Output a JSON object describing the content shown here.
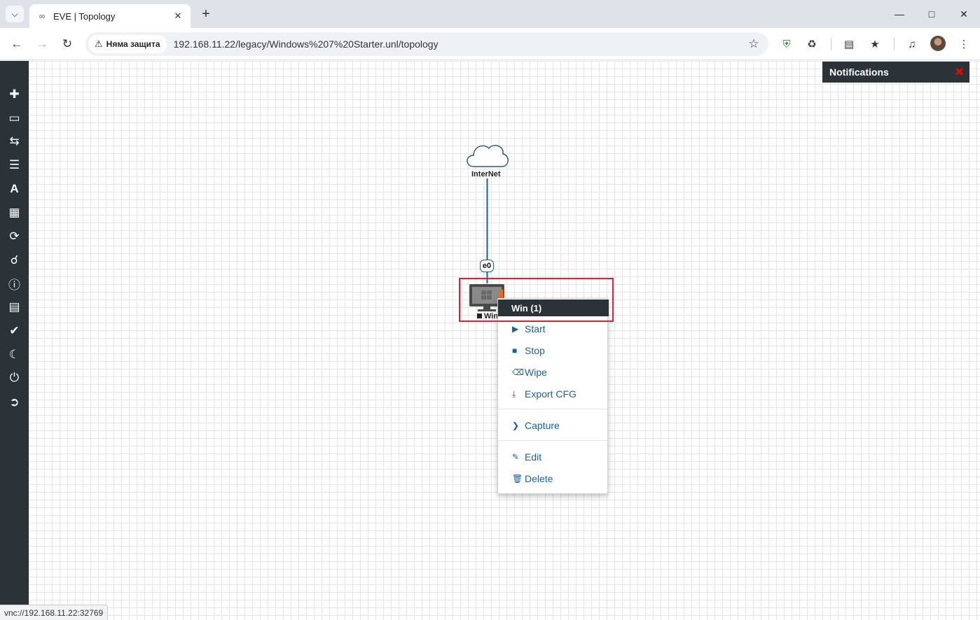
{
  "browser": {
    "tab_title": "EVE | Topology",
    "security_label": "Няма защита",
    "url": "192.168.11.22/legacy/Windows%207%20Starter.unl/topology",
    "status_url": "vnc://192.168.11.22:32769"
  },
  "notifications": {
    "title": "Notifications"
  },
  "sidebar": {
    "items": [
      {
        "icon": "plus-icon"
      },
      {
        "icon": "drive-icon"
      },
      {
        "icon": "transfer-icon"
      },
      {
        "icon": "align-left-icon"
      },
      {
        "icon": "font-icon"
      },
      {
        "icon": "grid-icon"
      },
      {
        "icon": "refresh-icon"
      },
      {
        "icon": "zoom-in-icon"
      },
      {
        "icon": "info-icon"
      },
      {
        "icon": "list-icon"
      },
      {
        "icon": "check-circle-icon"
      },
      {
        "icon": "moon-icon"
      },
      {
        "icon": "power-icon"
      },
      {
        "icon": "logout-icon"
      }
    ]
  },
  "topology": {
    "cloud_label": "InterNet",
    "port_label": "e0",
    "node_label": "Win"
  },
  "context_menu": {
    "title": "Win (1)",
    "items": {
      "start": "Start",
      "stop": "Stop",
      "wipe": "Wipe",
      "export": "Export CFG",
      "capture": "Capture",
      "edit": "Edit",
      "delete": "Delete"
    }
  },
  "colors": {
    "sidebar": "#2b3338",
    "link": "#1a5f9e",
    "highlight": "#e0202e"
  }
}
